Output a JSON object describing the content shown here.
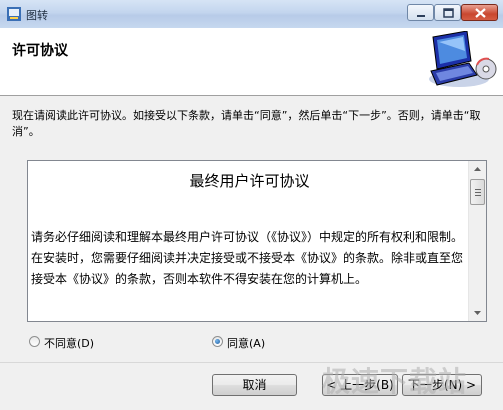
{
  "window": {
    "title": "图转",
    "title_buttons": [
      "minimize-icon",
      "maximize-icon",
      "close-icon"
    ]
  },
  "header": {
    "title": "许可协议",
    "graphic": "computer-cd-icon"
  },
  "instructions": "现在请阅读此许可协议。如接受以下条款，请单击“同意”，然后单击“下一步”。否则，请单击“取消”。",
  "license": {
    "heading": "最终用户许可协议",
    "body": "请务必仔细阅读和理解本最终用户许可协议（《协议》）中规定的所有权利和限制。在安装时，您需要仔细阅读并决定接受或不接受本《协议》的条款。除非或直至您接受本《协议》的条款，否则本软件不得安装在您的计算机上。"
  },
  "radios": {
    "disagree": {
      "label": "不同意(D)",
      "selected": false
    },
    "agree": {
      "label": "同意(A)",
      "selected": true
    }
  },
  "buttons": {
    "cancel": "取消",
    "back": "< 上一步(B)",
    "next": "下一步(N) >"
  },
  "watermark": "极速下载站"
}
